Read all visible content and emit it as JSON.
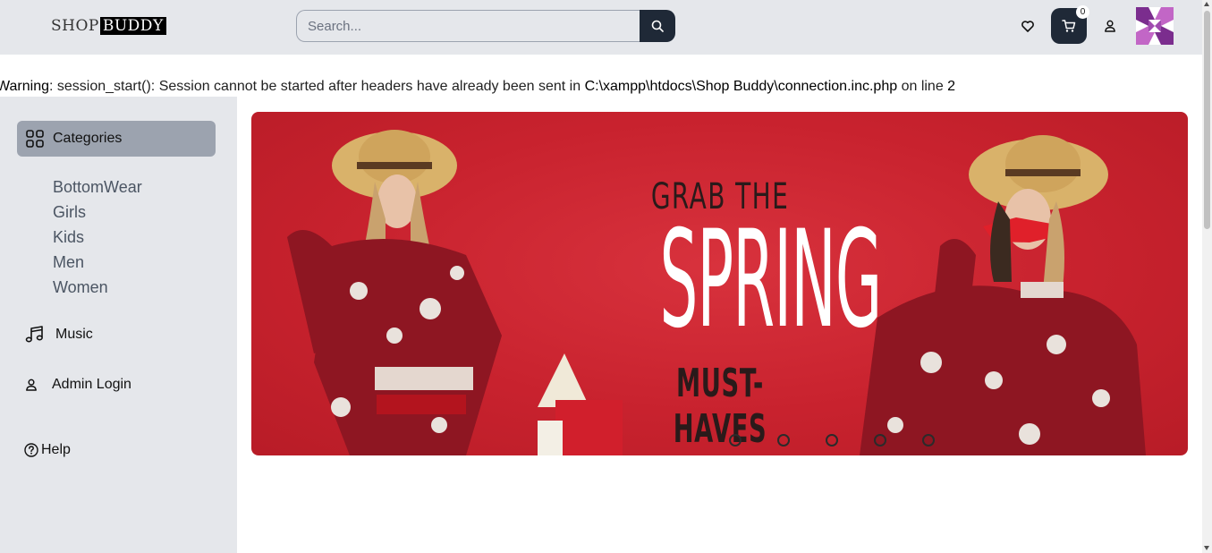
{
  "header": {
    "logo_part1": "SHOP",
    "logo_part2": "BUDDY",
    "search_placeholder": "Search...",
    "cart_count": "0",
    "icons": [
      "search-icon",
      "heart-icon",
      "cart-icon",
      "user-icon",
      "avatar"
    ]
  },
  "warning": {
    "prefix": "Warning",
    "message": ": session_start(): Session cannot be started after headers have already been sent in ",
    "path": "C:\\xampp\\htdocs\\Shop Buddy\\connection.inc.php",
    "on_line": " on line ",
    "line": "2"
  },
  "sidebar": {
    "categories_label": "Categories",
    "categories": [
      "BottomWear",
      "Girls",
      "Kids",
      "Men",
      "Women"
    ],
    "music_label": "Music",
    "admin_label": "Admin Login",
    "help_label": "Help"
  },
  "banner": {
    "line1": "GRAB THE",
    "line2": "SPRING",
    "line3": "MUST-HAVES",
    "slides": 5
  },
  "colors": {
    "topbar": "#e5e7eb",
    "dark_button": "#1f2937",
    "category_active": "#9ca3af",
    "banner_red": "#c8222e"
  }
}
